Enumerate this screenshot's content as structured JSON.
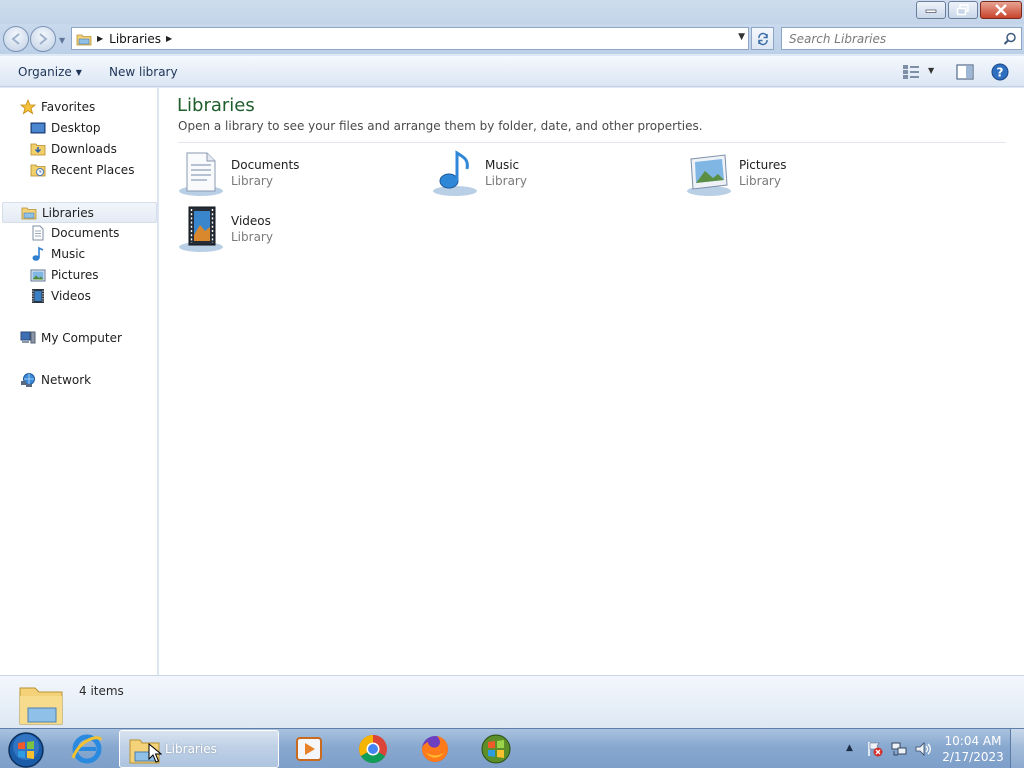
{
  "window": {
    "minimize_icon": "minimize-icon",
    "maximize_icon": "restore-icon",
    "close_icon": "close-icon"
  },
  "navigation": {
    "breadcrumb": [
      "Libraries"
    ],
    "search_placeholder": "Search Libraries"
  },
  "toolbar": {
    "organize_label": "Organize",
    "new_library_label": "New library"
  },
  "sidebar": {
    "favorites": {
      "label": "Favorites",
      "items": [
        {
          "label": "Desktop",
          "icon": "desktop-icon"
        },
        {
          "label": "Downloads",
          "icon": "downloads-icon"
        },
        {
          "label": "Recent Places",
          "icon": "recent-places-icon"
        }
      ]
    },
    "libraries": {
      "label": "Libraries",
      "items": [
        {
          "label": "Documents",
          "icon": "documents-icon"
        },
        {
          "label": "Music",
          "icon": "music-icon"
        },
        {
          "label": "Pictures",
          "icon": "pictures-icon"
        },
        {
          "label": "Videos",
          "icon": "videos-icon"
        }
      ]
    },
    "computer": {
      "label": "My Computer"
    },
    "network": {
      "label": "Network"
    }
  },
  "main": {
    "title": "Libraries",
    "subtitle": "Open a library to see your files and arrange them by folder, date, and other properties.",
    "libraries": [
      {
        "name": "Documents",
        "type": "Library",
        "icon": "documents-library-icon"
      },
      {
        "name": "Music",
        "type": "Library",
        "icon": "music-library-icon"
      },
      {
        "name": "Pictures",
        "type": "Library",
        "icon": "pictures-library-icon"
      },
      {
        "name": "Videos",
        "type": "Library",
        "icon": "videos-library-icon"
      }
    ]
  },
  "details": {
    "item_count": "4 items"
  },
  "taskbar": {
    "active_task_label": "Libraries",
    "pinned": [
      "internet-explorer-icon",
      "media-player-icon",
      "chrome-icon",
      "firefox-icon",
      "windows-logo-icon"
    ],
    "clock_time": "10:04 AM",
    "clock_date": "2/17/2023"
  },
  "colors": {
    "title_green": "#1e5d2c",
    "accent_blue": "#1e3457",
    "taskbar": "#88a8cf"
  }
}
